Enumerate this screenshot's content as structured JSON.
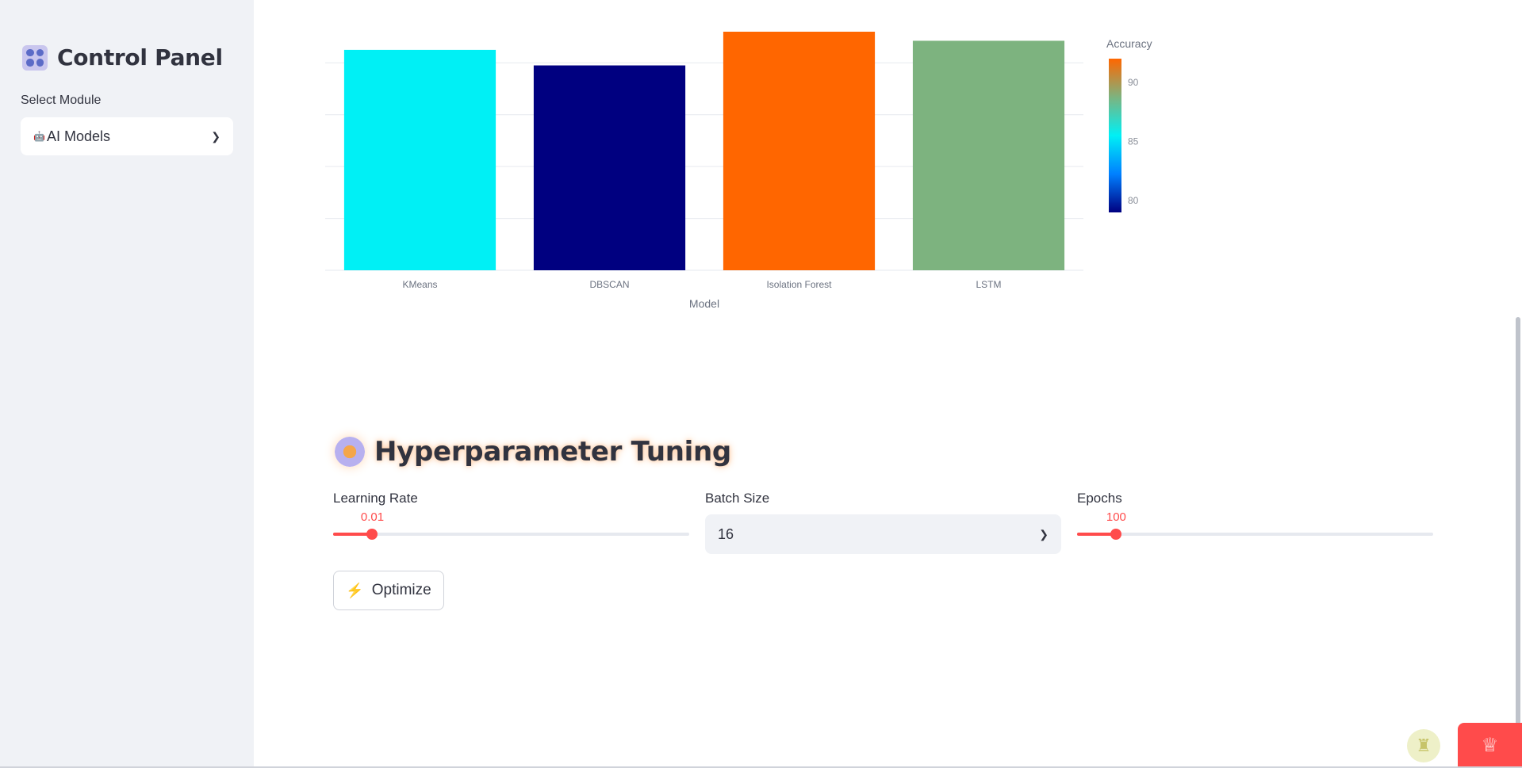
{
  "sidebar": {
    "title": "Control Panel",
    "title_icon": "control-knobs-icon",
    "select_label": "Select Module",
    "select_value_icon": "🤖",
    "select_value": "AI Models"
  },
  "chart_data": {
    "type": "bar",
    "categories": [
      "KMeans",
      "DBSCAN",
      "Isolation Forest",
      "LSTM"
    ],
    "values": [
      85,
      79,
      92,
      88.5
    ],
    "colors": [
      "#00f0f5",
      "#000080",
      "#ff6600",
      "#7db37f"
    ],
    "xlabel": "Model",
    "ylabel": "Accuracy",
    "ylim": [
      0,
      92
    ],
    "yticks": [
      0,
      20,
      40,
      60,
      80
    ],
    "grid": true,
    "colorbar": {
      "title": "Accuracy",
      "range": [
        79,
        92
      ],
      "ticks": [
        80,
        85,
        90
      ],
      "colors": [
        "#000080",
        "#0080ff",
        "#00f0f5",
        "#7db37f",
        "#ff6600"
      ]
    }
  },
  "tuning": {
    "title": "Hyperparameter Tuning",
    "title_icon": "gear-icon",
    "learning_rate": {
      "label": "Learning Rate",
      "value": "0.01",
      "fraction": 0.11
    },
    "batch_size": {
      "label": "Batch Size",
      "value": "16"
    },
    "epochs": {
      "label": "Epochs",
      "value": "100",
      "fraction": 0.11
    },
    "optimize_label": "Optimize"
  },
  "colors": {
    "accent": "#ff4b4b",
    "sidebar_bg": "#f0f2f6"
  }
}
